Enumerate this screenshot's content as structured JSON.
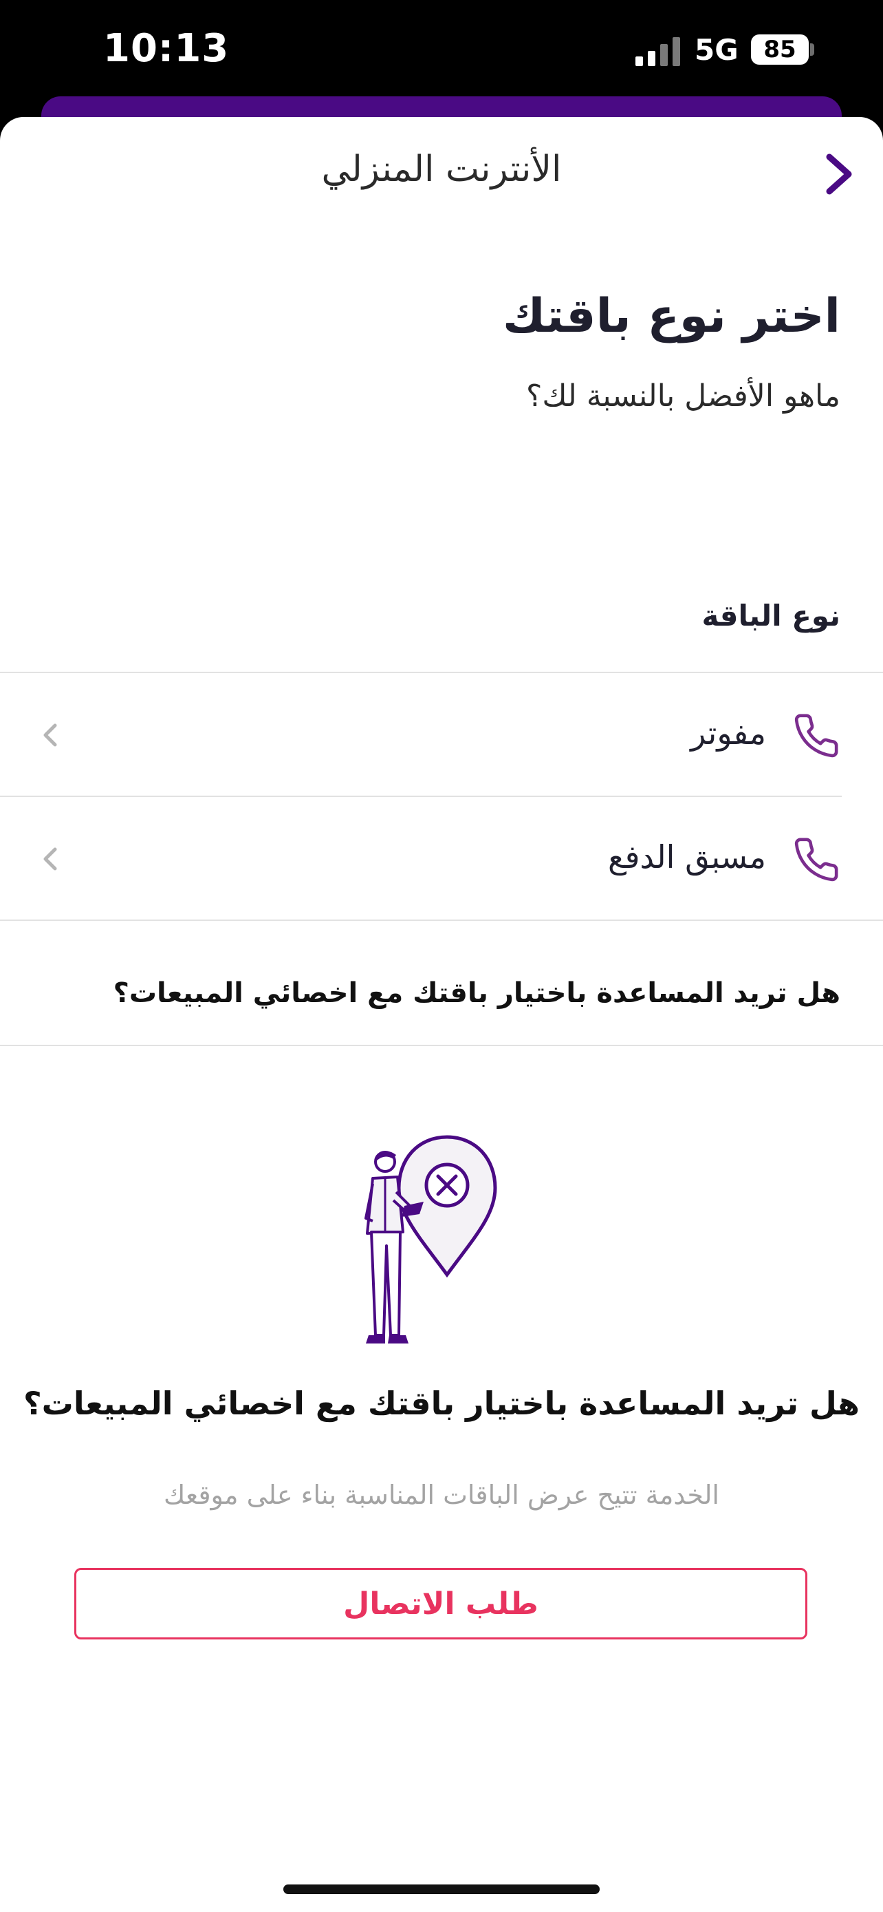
{
  "status_bar": {
    "time": "10:13",
    "network": "5G",
    "battery": "85"
  },
  "header": {
    "title": "الأنترنت المنزلي"
  },
  "intro": {
    "heading": "اختر نوع باقتك",
    "subheading": "ماهو الأفضل بالنسبة لك؟"
  },
  "plan_type": {
    "label": "نوع الباقة",
    "options": [
      {
        "label": "مفوتر",
        "icon": "phone-icon"
      },
      {
        "label": "مسبق الدفع",
        "icon": "phone-icon"
      }
    ]
  },
  "assist": {
    "question": "هل تريد المساعدة باختيار باقتك مع اخصائي المبيعات؟",
    "card_title": "هل تريد المساعدة باختيار باقتك مع اخصائي المبيعات؟",
    "card_description": "الخدمة تتيح عرض الباقات المناسبة بناء على موقعك",
    "button_label": "طلب الاتصال",
    "illustration": "person-with-location-pin-illustration"
  },
  "colors": {
    "brand_purple": "#4a0a84",
    "icon_purple": "#7b2d8e",
    "accent_pink": "#e8335f"
  }
}
